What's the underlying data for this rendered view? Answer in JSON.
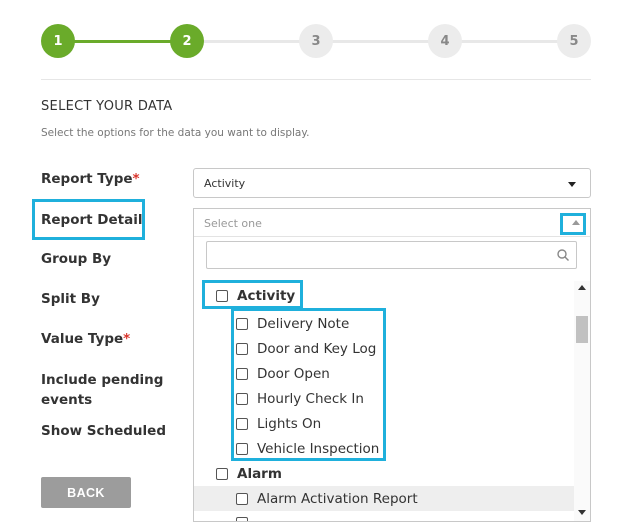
{
  "stepper": {
    "steps": [
      {
        "label": "1",
        "state": "done"
      },
      {
        "label": "2",
        "state": "done"
      },
      {
        "label": "3",
        "state": "todo"
      },
      {
        "label": "4",
        "state": "todo"
      },
      {
        "label": "5",
        "state": "todo"
      }
    ],
    "done_color": "#6aab2a",
    "todo_color": "#ececec"
  },
  "section": {
    "title": "SELECT YOUR DATA",
    "subtitle": "Select the options for the data you want to display."
  },
  "form": {
    "report_type_label": "Report Type",
    "report_detail_label": "Report Detail",
    "group_by_label": "Group By",
    "split_by_label": "Split By",
    "value_type_label": "Value Type",
    "include_pending_label_1": "Include pending",
    "include_pending_label_2": "events",
    "show_scheduled_label": "Show Scheduled",
    "required_mark": "*",
    "report_type_value": "Activity"
  },
  "dropdown": {
    "placeholder": "Select one",
    "groups": [
      {
        "label": "Activity",
        "items": [
          "Delivery Note",
          "Door and Key Log",
          "Door Open",
          "Hourly Check In",
          "Lights On",
          "Vehicle Inspection"
        ]
      },
      {
        "label": "Alarm",
        "items": [
          "Alarm Activation Report"
        ]
      }
    ]
  },
  "buttons": {
    "back": "BACK"
  },
  "colors": {
    "highlight": "#1fb0dc",
    "required": "#d9342b"
  }
}
